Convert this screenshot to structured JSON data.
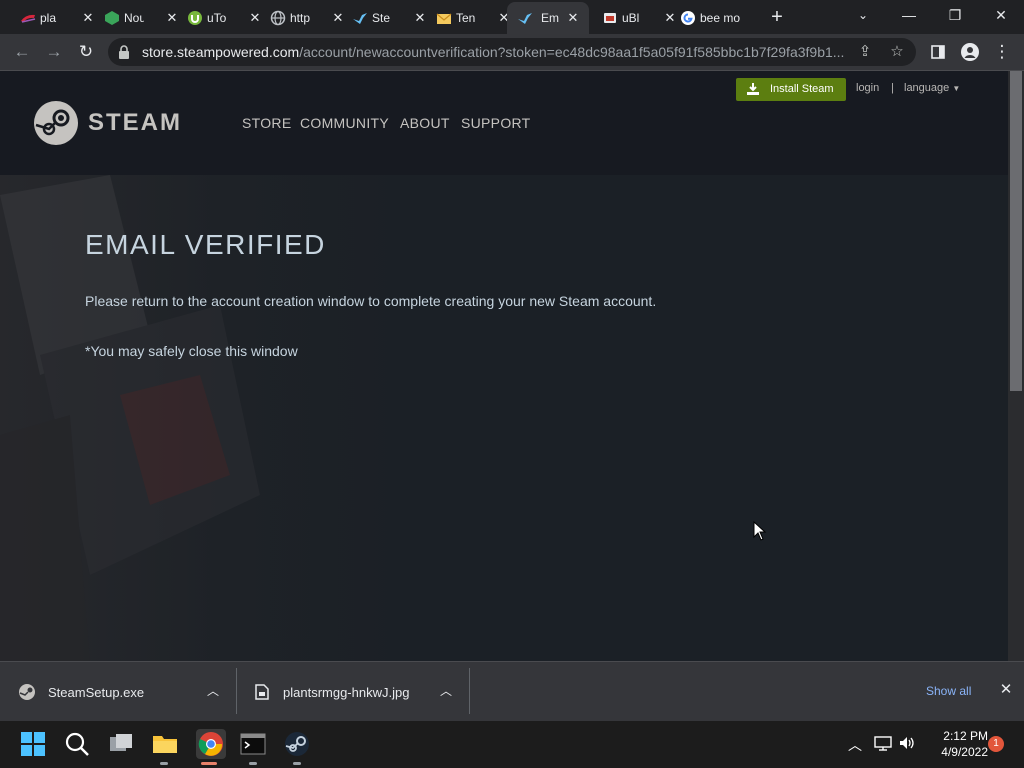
{
  "browser": {
    "tabs": [
      {
        "title": "pla",
        "icon": "horizon-icon"
      },
      {
        "title": "Nou",
        "icon": "green-cube-icon"
      },
      {
        "title": "uTo",
        "icon": "utorrent-icon"
      },
      {
        "title": "http",
        "icon": "globe-icon"
      },
      {
        "title": "Ste",
        "icon": "steam-icon"
      },
      {
        "title": "Ten",
        "icon": "mail-icon"
      },
      {
        "title": "Em",
        "icon": "steam-icon",
        "active": true
      },
      {
        "title": "uBl",
        "icon": "ublock-icon"
      },
      {
        "title": "bee mo",
        "icon": "google-icon"
      }
    ],
    "url_host": "store.steampowered.com",
    "url_path": "/account/newaccountverification?stoken=ec48dc98aa1f5a05f91f585bbc1b7f29fa3f9b1..."
  },
  "steam": {
    "logo_text": "STEAM",
    "nav": [
      "STORE",
      "COMMUNITY",
      "ABOUT",
      "SUPPORT"
    ],
    "install_label": "Install Steam",
    "login_label": "login",
    "separator": "|",
    "language_label": "language",
    "heading": "EMAIL VERIFIED",
    "message": "Please return to the account creation window to complete creating your new Steam account.",
    "note": "*You may safely close this window",
    "colors": {
      "install_green": "#5c7e10",
      "header_bg": "#171a21",
      "text": "#c6d4df"
    }
  },
  "downloads": {
    "items": [
      {
        "name": "SteamSetup.exe",
        "icon": "steam-icon"
      },
      {
        "name": "plantsrmgg-hnkwJ.jpg",
        "icon": "file-icon"
      }
    ],
    "show_all": "Show all"
  },
  "taskbar": {
    "time": "2:12 PM",
    "date": "4/9/2022",
    "notifications": "1"
  }
}
